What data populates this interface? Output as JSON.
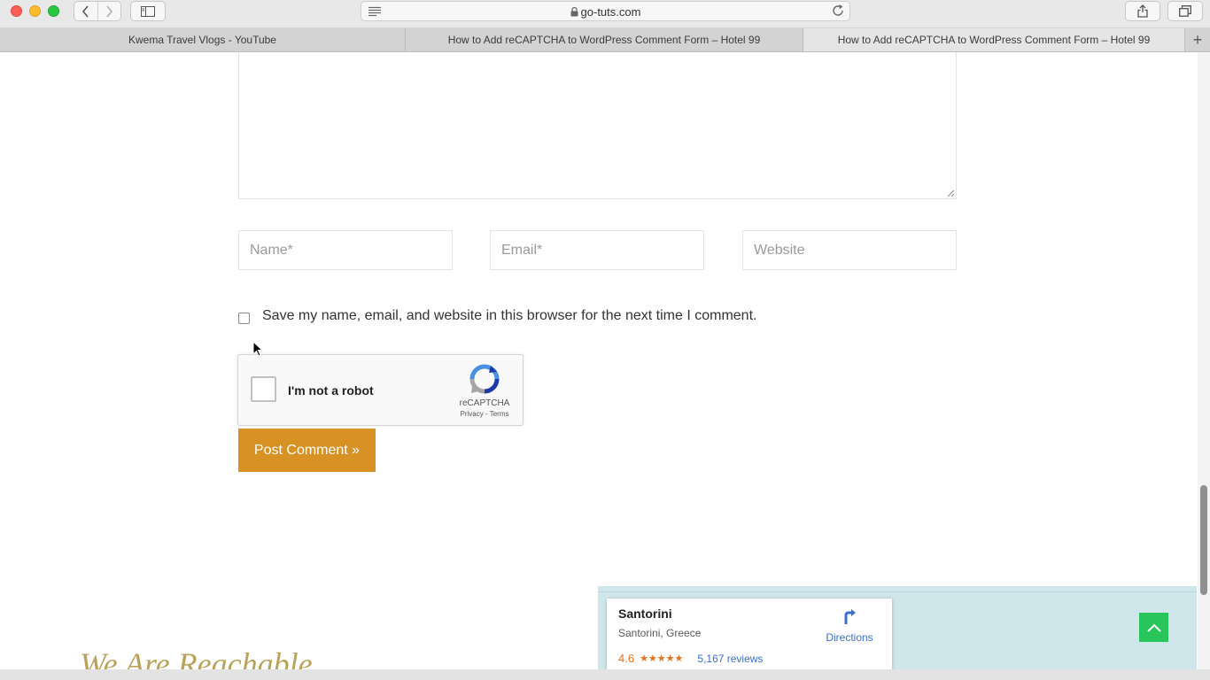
{
  "browser": {
    "url": "go-tuts.com",
    "tabs": [
      {
        "label": "Kwema Travel Vlogs - YouTube",
        "active": false
      },
      {
        "label": "How to Add reCAPTCHA to WordPress Comment Form – Hotel 99",
        "active": false
      },
      {
        "label": "How to Add reCAPTCHA to WordPress Comment Form – Hotel 99",
        "active": true
      }
    ],
    "new_tab_symbol": "+",
    "back_symbol": "‹",
    "forward_symbol": "›",
    "lock_symbol": "🔒"
  },
  "comment_form": {
    "name_placeholder": "Name*",
    "email_placeholder": "Email*",
    "website_placeholder": "Website",
    "save_label": "Save my name, email, and website in this browser for the next time I comment.",
    "recaptcha": {
      "label": "I'm not a robot",
      "brand": "reCAPTCHA",
      "terms": "Privacy - Terms"
    },
    "submit_label": "Post Comment »",
    "submit_color": "#d79223"
  },
  "footer": {
    "heading": "We Are Reachable"
  },
  "map": {
    "place_name": "Santorini",
    "place_location": "Santorini, Greece",
    "rating": "4.6",
    "stars": "★★★★★",
    "reviews": "5,167 reviews",
    "directions_label": "Directions"
  },
  "colors": {
    "accent": "#d79223",
    "back_to_top": "#27c55a",
    "link": "#3a6fd1"
  }
}
